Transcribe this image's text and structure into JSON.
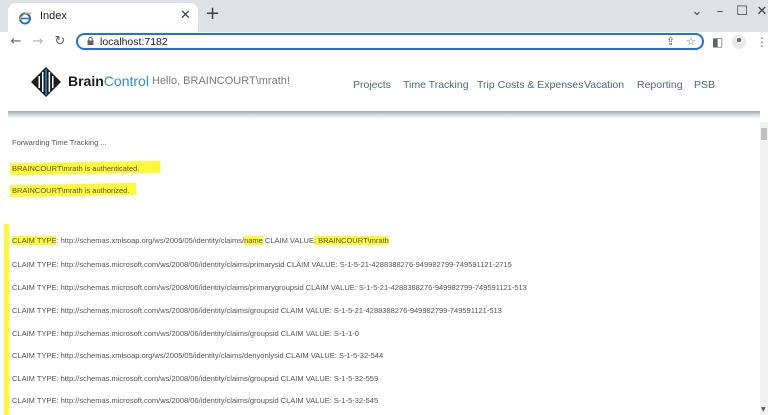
{
  "browser": {
    "tab_title": "Index",
    "url": "localhost:7182",
    "icons": [
      "ie-favicon-icon",
      "close-icon",
      "plus-icon",
      "back-icon",
      "forward-icon",
      "reload-icon",
      "lock-icon",
      "share-icon",
      "star-icon",
      "sidebar-icon",
      "profile-icon",
      "menu-icon"
    ]
  },
  "site": {
    "brand_part1": "Brain",
    "brand_part2": "Control",
    "greeting": "Hello, BRAINCOURT\\mrath!",
    "nav": [
      "Projects",
      "Time Tracking",
      "Trip Costs & Expenses",
      "Vacation",
      "Reporting",
      "PSB"
    ]
  },
  "content": {
    "forwarding": "Forwarding Time Tracking ...",
    "authenticated": "BRAINCOURT\\mrath is authenticated.",
    "authorized": "BRAINCOURT\\mrath is authorized.",
    "claim_type_label": "CLAIM TYPE",
    "claim_value_label": "CLAIM VALUE",
    "first_claim": {
      "uri_prefix": ": http://schemas.xmlsoap.org/ws/2005/05/identity/claims/",
      "uri_tail": "name",
      "value_text": ": BRAINCOURT\\mrath"
    },
    "claims": [
      "CLAIM TYPE: http://schemas.microsoft.com/ws/2008/06/identity/claims/primarysid CLAIM VALUE: S-1-5-21-4288388276-949982799-749591121-2715",
      "CLAIM TYPE: http://schemas.microsoft.com/ws/2008/06/identity/claims/primarygroupsid CLAIM VALUE: S-1-5-21-4288388276-949982799-749591121-513",
      "CLAIM TYPE: http://schemas.microsoft.com/ws/2008/06/identity/claims/groupsid CLAIM VALUE: S-1-5-21-4288388276-949982799-749591121-513",
      "CLAIM TYPE: http://schemas.microsoft.com/ws/2008/06/identity/claims/groupsid CLAIM VALUE: S-1-1-0",
      "CLAIM TYPE: http://schemas.xmlsoap.org/ws/2005/05/identity/claims/denyonlysid CLAIM VALUE: S-1-5-32-544",
      "CLAIM TYPE: http://schemas.microsoft.com/ws/2008/06/identity/claims/groupsid CLAIM VALUE: S-1-5-32-559",
      "CLAIM TYPE: http://schemas.microsoft.com/ws/2008/06/identity/claims/groupsid CLAIM VALUE: S-1-5-32-545"
    ]
  },
  "colors": {
    "highlight": "#fff93a",
    "accent": "#1a73e8",
    "brand_blue": "#2a8fd6",
    "nav_text": "#4a6a86"
  }
}
